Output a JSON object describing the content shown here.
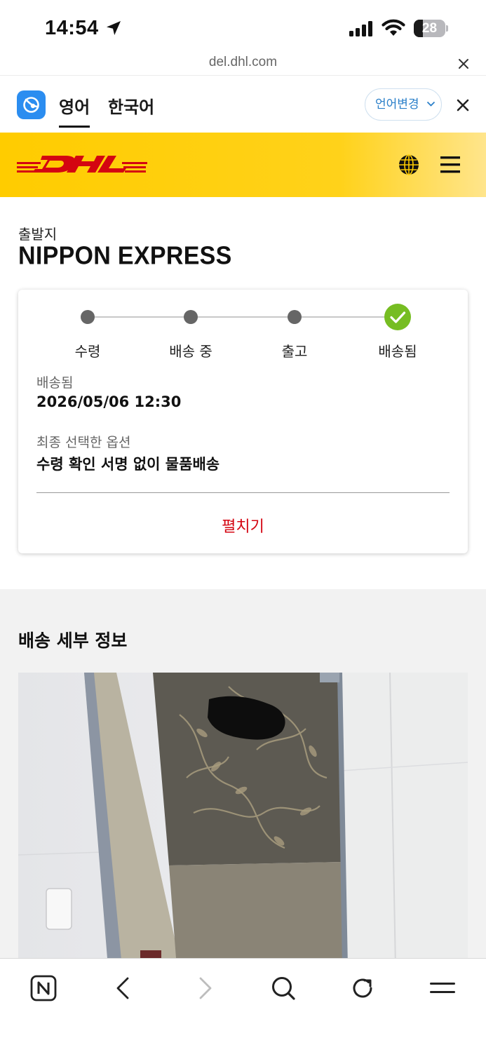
{
  "status_bar": {
    "time": "14:54",
    "battery_level": "28",
    "icons": [
      "location-arrow-icon",
      "cellular-signal-icon",
      "wifi-icon",
      "battery-icon"
    ]
  },
  "browser": {
    "url": "del.dhl.com",
    "close_icon": "close-icon"
  },
  "translate_bar": {
    "app_icon": "papago-translate-icon",
    "tabs": [
      {
        "label": "영어",
        "active": true
      },
      {
        "label": "한국어",
        "active": false
      }
    ],
    "change_language_label": "언어변경",
    "close_icon": "close-icon"
  },
  "header": {
    "logo": "DHL",
    "brand_color": "#ffcc00",
    "logo_color": "#d40511",
    "icons": [
      "globe-icon",
      "hamburger-menu-icon"
    ]
  },
  "origin": {
    "label": "출발지",
    "value": "NIPPON EXPRESS"
  },
  "status_card": {
    "steps": [
      {
        "label": "수령",
        "state": "done"
      },
      {
        "label": "배송 중",
        "state": "done"
      },
      {
        "label": "출고",
        "state": "done"
      },
      {
        "label": "배송됨",
        "state": "current"
      }
    ],
    "delivered_label": "배송됨",
    "delivered_value": "2026/05/06 12:30",
    "option_label": "최종 선택한 옵션",
    "option_value": "수령 확인 서명 없이 물품배송",
    "expand_label": "펼치기",
    "check_color": "#76bd22",
    "link_color": "#d40511"
  },
  "details": {
    "title": "배송 세부 정보",
    "photo": "delivery-photo-door"
  },
  "toolbar": {
    "icons": [
      "naver-home-icon",
      "back-arrow-icon",
      "forward-arrow-icon",
      "search-icon",
      "refresh-icon",
      "menu-icon"
    ]
  }
}
